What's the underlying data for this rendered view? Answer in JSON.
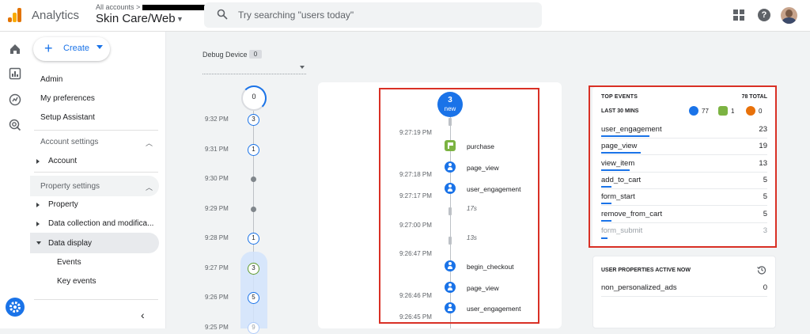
{
  "header": {
    "app_name": "Analytics",
    "account_breadcrumb": "All accounts >",
    "property_name": "Skin Care/Web",
    "search_placeholder": "Try searching \"users today\""
  },
  "nav": {
    "create_label": "Create",
    "items": [
      "Admin",
      "My preferences",
      "Setup Assistant"
    ],
    "account_settings": "Account settings",
    "account": "Account",
    "property_settings": "Property settings",
    "property": "Property",
    "data_collection": "Data collection and modifica...",
    "data_display": "Data display",
    "events": "Events",
    "key_events": "Key events"
  },
  "debug": {
    "label": "Debug Device",
    "count": "0"
  },
  "timeline": {
    "top_count": "0",
    "rows": [
      {
        "time": "9:32 PM",
        "kind": "node",
        "value": "3"
      },
      {
        "time": "9:31 PM",
        "kind": "node",
        "value": "1"
      },
      {
        "time": "9:30 PM",
        "kind": "dot",
        "value": ""
      },
      {
        "time": "9:29 PM",
        "kind": "dot",
        "value": ""
      },
      {
        "time": "9:28 PM",
        "kind": "node",
        "value": "1"
      },
      {
        "time": "9:27 PM",
        "kind": "node-green",
        "value": "3"
      },
      {
        "time": "9:26 PM",
        "kind": "node",
        "value": "5"
      },
      {
        "time": "9:25 PM",
        "kind": "node-faint",
        "value": "9"
      }
    ]
  },
  "stream": {
    "top_count": "3",
    "top_label": "new",
    "times": [
      "9:27:19 PM",
      "9:27:18 PM",
      "9:27:17 PM",
      "9:27:00 PM",
      "9:26:47 PM",
      "9:26:46 PM",
      "9:26:45 PM"
    ],
    "gaps": [
      "17s",
      "13s"
    ],
    "events": [
      {
        "name": "purchase",
        "type": "conversion"
      },
      {
        "name": "page_view",
        "type": "event"
      },
      {
        "name": "user_engagement",
        "type": "event"
      },
      {
        "name": "begin_checkout",
        "type": "event"
      },
      {
        "name": "page_view",
        "type": "event"
      },
      {
        "name": "user_engagement",
        "type": "event"
      }
    ]
  },
  "top_events": {
    "title": "TOP EVENTS",
    "total": "78 TOTAL",
    "subtitle": "LAST 30 MINS",
    "badges": [
      {
        "value": "77",
        "color": "#1a73e8"
      },
      {
        "value": "1",
        "color": "#7cb342"
      },
      {
        "value": "0",
        "color": "#e8710a"
      }
    ],
    "rows": [
      {
        "name": "user_engagement",
        "count": "23",
        "share": 0.29
      },
      {
        "name": "page_view",
        "count": "19",
        "share": 0.24
      },
      {
        "name": "view_item",
        "count": "13",
        "share": 0.17
      },
      {
        "name": "add_to_cart",
        "count": "5",
        "share": 0.06
      },
      {
        "name": "form_start",
        "count": "5",
        "share": 0.06
      },
      {
        "name": "remove_from_cart",
        "count": "5",
        "share": 0.06
      },
      {
        "name": "form_submit",
        "count": "3",
        "share": 0.04
      }
    ]
  },
  "user_properties": {
    "title": "USER PROPERTIES ACTIVE NOW",
    "rows": [
      {
        "name": "non_personalized_ads",
        "value": "0"
      }
    ]
  },
  "colors": {
    "accent": "#1a73e8",
    "highlight_frame": "#d93025",
    "conversion": "#7cb342"
  }
}
